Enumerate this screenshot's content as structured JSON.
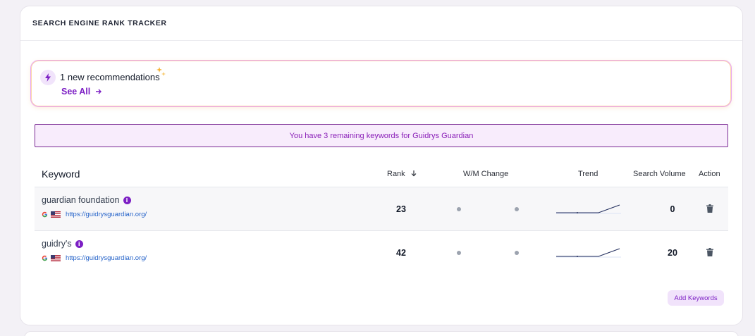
{
  "header": {
    "title": "SEARCH ENGINE RANK TRACKER"
  },
  "recommendation": {
    "text": "1 new recommendations",
    "link_label": "See All"
  },
  "notice": {
    "text": "You have 3 remaining keywords for Guidrys Guardian"
  },
  "table": {
    "columns": {
      "keyword": "Keyword",
      "rank": "Rank",
      "change": "W/M Change",
      "trend": "Trend",
      "volume": "Search Volume",
      "action": "Action"
    },
    "rows": [
      {
        "keyword": "guardian foundation",
        "url": "https://guidrysguardian.org/",
        "rank": "23",
        "volume": "0"
      },
      {
        "keyword": "guidry's",
        "url": "https://guidrysguardian.org/",
        "rank": "42",
        "volume": "20"
      }
    ]
  },
  "actions": {
    "add_keywords": "Add Keywords"
  },
  "colors": {
    "accent": "#7c1fc4",
    "notice_bg": "#f8ecfc",
    "notice_border": "#7a2a93",
    "link": "#2563c9"
  }
}
